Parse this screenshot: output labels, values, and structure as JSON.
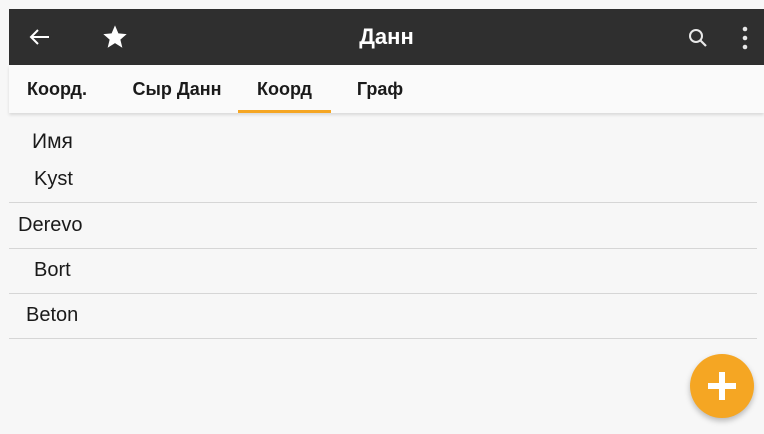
{
  "appbar": {
    "title": "Данн",
    "icons": [
      "back-arrow-icon",
      "star-icon",
      "search-icon",
      "more-vert-icon"
    ],
    "background": "#2f2f2f"
  },
  "tabs": [
    {
      "label": "Коорд."
    },
    {
      "label": "Сыр Данн"
    },
    {
      "label": "Коорд",
      "active": true
    },
    {
      "label": "Граф"
    }
  ],
  "accent": "#f5a623",
  "table": {
    "header": "Имя",
    "rows": [
      "Kyst",
      "Derevo",
      "Bort",
      "Beton"
    ]
  },
  "fab": {
    "icon": "plus-icon"
  }
}
